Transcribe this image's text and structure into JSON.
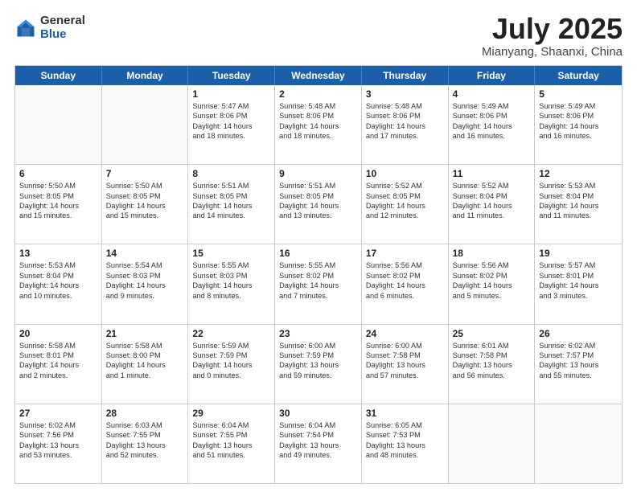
{
  "logo": {
    "general": "General",
    "blue": "Blue"
  },
  "title": {
    "month_year": "July 2025",
    "location": "Mianyang, Shaanxi, China"
  },
  "header_days": [
    "Sunday",
    "Monday",
    "Tuesday",
    "Wednesday",
    "Thursday",
    "Friday",
    "Saturday"
  ],
  "weeks": [
    [
      {
        "day": "",
        "lines": []
      },
      {
        "day": "",
        "lines": []
      },
      {
        "day": "1",
        "lines": [
          "Sunrise: 5:47 AM",
          "Sunset: 8:06 PM",
          "Daylight: 14 hours",
          "and 18 minutes."
        ]
      },
      {
        "day": "2",
        "lines": [
          "Sunrise: 5:48 AM",
          "Sunset: 8:06 PM",
          "Daylight: 14 hours",
          "and 18 minutes."
        ]
      },
      {
        "day": "3",
        "lines": [
          "Sunrise: 5:48 AM",
          "Sunset: 8:06 PM",
          "Daylight: 14 hours",
          "and 17 minutes."
        ]
      },
      {
        "day": "4",
        "lines": [
          "Sunrise: 5:49 AM",
          "Sunset: 8:06 PM",
          "Daylight: 14 hours",
          "and 16 minutes."
        ]
      },
      {
        "day": "5",
        "lines": [
          "Sunrise: 5:49 AM",
          "Sunset: 8:06 PM",
          "Daylight: 14 hours",
          "and 16 minutes."
        ]
      }
    ],
    [
      {
        "day": "6",
        "lines": [
          "Sunrise: 5:50 AM",
          "Sunset: 8:05 PM",
          "Daylight: 14 hours",
          "and 15 minutes."
        ]
      },
      {
        "day": "7",
        "lines": [
          "Sunrise: 5:50 AM",
          "Sunset: 8:05 PM",
          "Daylight: 14 hours",
          "and 15 minutes."
        ]
      },
      {
        "day": "8",
        "lines": [
          "Sunrise: 5:51 AM",
          "Sunset: 8:05 PM",
          "Daylight: 14 hours",
          "and 14 minutes."
        ]
      },
      {
        "day": "9",
        "lines": [
          "Sunrise: 5:51 AM",
          "Sunset: 8:05 PM",
          "Daylight: 14 hours",
          "and 13 minutes."
        ]
      },
      {
        "day": "10",
        "lines": [
          "Sunrise: 5:52 AM",
          "Sunset: 8:05 PM",
          "Daylight: 14 hours",
          "and 12 minutes."
        ]
      },
      {
        "day": "11",
        "lines": [
          "Sunrise: 5:52 AM",
          "Sunset: 8:04 PM",
          "Daylight: 14 hours",
          "and 11 minutes."
        ]
      },
      {
        "day": "12",
        "lines": [
          "Sunrise: 5:53 AM",
          "Sunset: 8:04 PM",
          "Daylight: 14 hours",
          "and 11 minutes."
        ]
      }
    ],
    [
      {
        "day": "13",
        "lines": [
          "Sunrise: 5:53 AM",
          "Sunset: 8:04 PM",
          "Daylight: 14 hours",
          "and 10 minutes."
        ]
      },
      {
        "day": "14",
        "lines": [
          "Sunrise: 5:54 AM",
          "Sunset: 8:03 PM",
          "Daylight: 14 hours",
          "and 9 minutes."
        ]
      },
      {
        "day": "15",
        "lines": [
          "Sunrise: 5:55 AM",
          "Sunset: 8:03 PM",
          "Daylight: 14 hours",
          "and 8 minutes."
        ]
      },
      {
        "day": "16",
        "lines": [
          "Sunrise: 5:55 AM",
          "Sunset: 8:02 PM",
          "Daylight: 14 hours",
          "and 7 minutes."
        ]
      },
      {
        "day": "17",
        "lines": [
          "Sunrise: 5:56 AM",
          "Sunset: 8:02 PM",
          "Daylight: 14 hours",
          "and 6 minutes."
        ]
      },
      {
        "day": "18",
        "lines": [
          "Sunrise: 5:56 AM",
          "Sunset: 8:02 PM",
          "Daylight: 14 hours",
          "and 5 minutes."
        ]
      },
      {
        "day": "19",
        "lines": [
          "Sunrise: 5:57 AM",
          "Sunset: 8:01 PM",
          "Daylight: 14 hours",
          "and 3 minutes."
        ]
      }
    ],
    [
      {
        "day": "20",
        "lines": [
          "Sunrise: 5:58 AM",
          "Sunset: 8:01 PM",
          "Daylight: 14 hours",
          "and 2 minutes."
        ]
      },
      {
        "day": "21",
        "lines": [
          "Sunrise: 5:58 AM",
          "Sunset: 8:00 PM",
          "Daylight: 14 hours",
          "and 1 minute."
        ]
      },
      {
        "day": "22",
        "lines": [
          "Sunrise: 5:59 AM",
          "Sunset: 7:59 PM",
          "Daylight: 14 hours",
          "and 0 minutes."
        ]
      },
      {
        "day": "23",
        "lines": [
          "Sunrise: 6:00 AM",
          "Sunset: 7:59 PM",
          "Daylight: 13 hours",
          "and 59 minutes."
        ]
      },
      {
        "day": "24",
        "lines": [
          "Sunrise: 6:00 AM",
          "Sunset: 7:58 PM",
          "Daylight: 13 hours",
          "and 57 minutes."
        ]
      },
      {
        "day": "25",
        "lines": [
          "Sunrise: 6:01 AM",
          "Sunset: 7:58 PM",
          "Daylight: 13 hours",
          "and 56 minutes."
        ]
      },
      {
        "day": "26",
        "lines": [
          "Sunrise: 6:02 AM",
          "Sunset: 7:57 PM",
          "Daylight: 13 hours",
          "and 55 minutes."
        ]
      }
    ],
    [
      {
        "day": "27",
        "lines": [
          "Sunrise: 6:02 AM",
          "Sunset: 7:56 PM",
          "Daylight: 13 hours",
          "and 53 minutes."
        ]
      },
      {
        "day": "28",
        "lines": [
          "Sunrise: 6:03 AM",
          "Sunset: 7:55 PM",
          "Daylight: 13 hours",
          "and 52 minutes."
        ]
      },
      {
        "day": "29",
        "lines": [
          "Sunrise: 6:04 AM",
          "Sunset: 7:55 PM",
          "Daylight: 13 hours",
          "and 51 minutes."
        ]
      },
      {
        "day": "30",
        "lines": [
          "Sunrise: 6:04 AM",
          "Sunset: 7:54 PM",
          "Daylight: 13 hours",
          "and 49 minutes."
        ]
      },
      {
        "day": "31",
        "lines": [
          "Sunrise: 6:05 AM",
          "Sunset: 7:53 PM",
          "Daylight: 13 hours",
          "and 48 minutes."
        ]
      },
      {
        "day": "",
        "lines": []
      },
      {
        "day": "",
        "lines": []
      }
    ]
  ]
}
